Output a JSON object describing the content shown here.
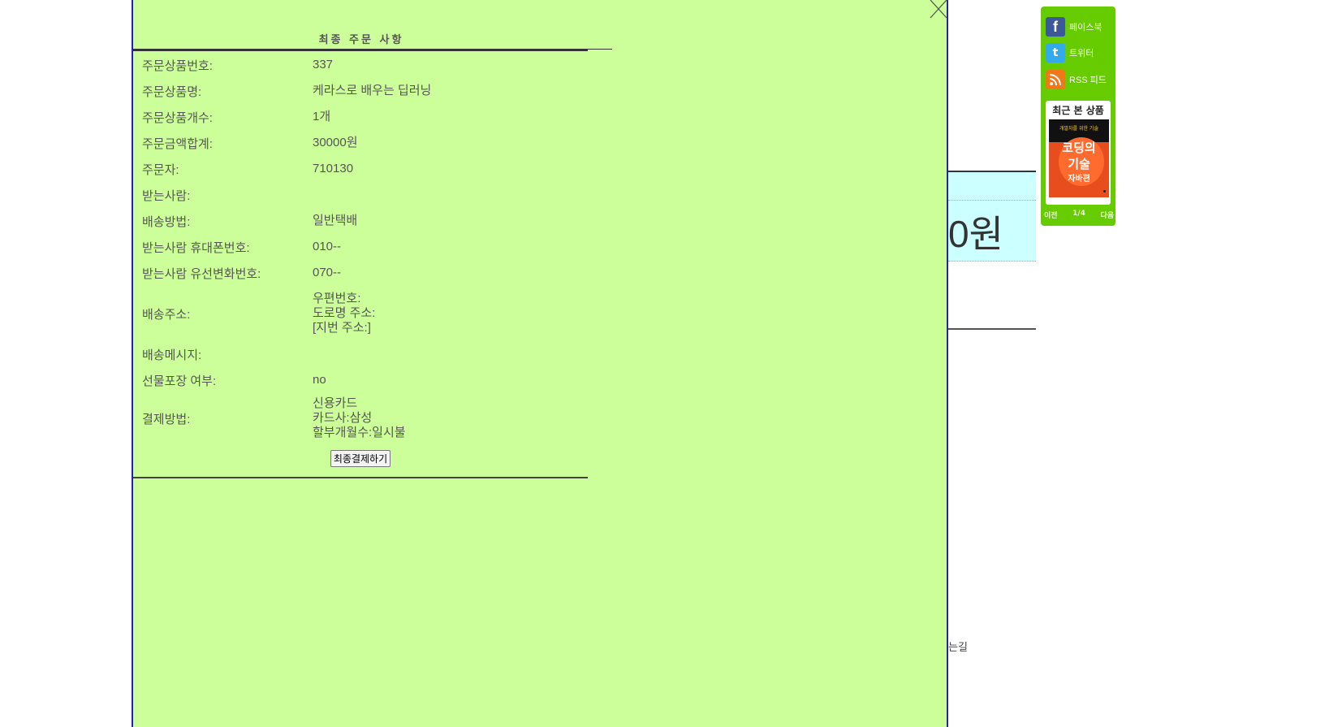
{
  "modal": {
    "title": "최종 주문 사항",
    "rows": [
      {
        "label": "주문상품번호:",
        "value": "337"
      },
      {
        "label": "주문상품명:",
        "value": "케라스로 배우는 딥러닝"
      },
      {
        "label": "주문상품개수:",
        "value": "1개"
      },
      {
        "label": "주문금액합계:",
        "value": "30000원"
      },
      {
        "label": "주문자:",
        "value": "710130"
      },
      {
        "label": "받는사람:",
        "value": ""
      },
      {
        "label": "배송방법:",
        "value": "일반택배"
      },
      {
        "label": "받는사람 휴대폰번호:",
        "value": "010--"
      },
      {
        "label": "받는사람 유선변화번호:",
        "value": "070--"
      }
    ],
    "address": {
      "label": "배송주소:",
      "lines": [
        "우편번호:",
        "도로명 주소:",
        "[지번 주소:]"
      ]
    },
    "message": {
      "label": "배송메시지:",
      "value": ""
    },
    "gift": {
      "label": "선물포장 여부:",
      "value": "no"
    },
    "payment": {
      "label": "결제방법:",
      "lines": [
        "신용카드",
        "카드사:삼성",
        "할부개월수:일시불"
      ]
    },
    "submit_label": "최종결제하기"
  },
  "background": {
    "price_fragment": "0원",
    "road_fragment": "는길"
  },
  "widget": {
    "share": [
      {
        "icon": "facebook-icon",
        "label": "페이스북"
      },
      {
        "icon": "twitter-icon",
        "label": "트위터"
      },
      {
        "icon": "rss-icon",
        "label": "RSS 피드"
      }
    ],
    "recent_title": "최근 본 상품",
    "book": {
      "subtitle": "개발자를 위한 기술",
      "title_line1": "코딩의",
      "title_line2": "기술",
      "title_line3": "자바편"
    },
    "pager": {
      "prev": "이전",
      "page": "1/4",
      "next": "다음"
    }
  },
  "colors": {
    "modal_bg": "#ccff99",
    "modal_border": "#2222bb",
    "widget_bg": "#66cc00",
    "band_bg": "#ccffff"
  }
}
